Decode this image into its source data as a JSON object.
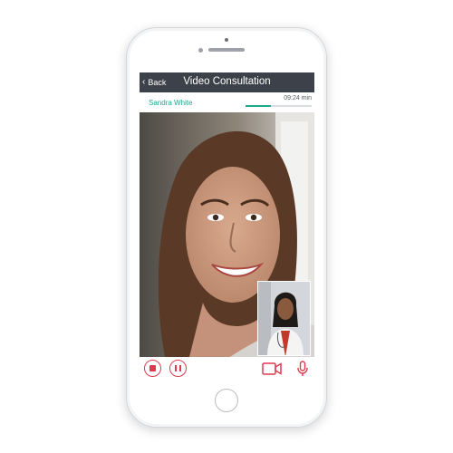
{
  "nav": {
    "back_label": "Back",
    "title": "Video Consultation"
  },
  "call": {
    "patient_name": "Sandra White",
    "timer": "09:24 min",
    "progress": 0.38
  },
  "icons": {
    "stop": "stop-icon",
    "pause": "pause-icon",
    "camera": "video-camera-icon",
    "mic": "microphone-icon"
  },
  "colors": {
    "accent_green": "#1aa98f",
    "control_red": "#e0394e",
    "navbar": "#3d4149"
  }
}
